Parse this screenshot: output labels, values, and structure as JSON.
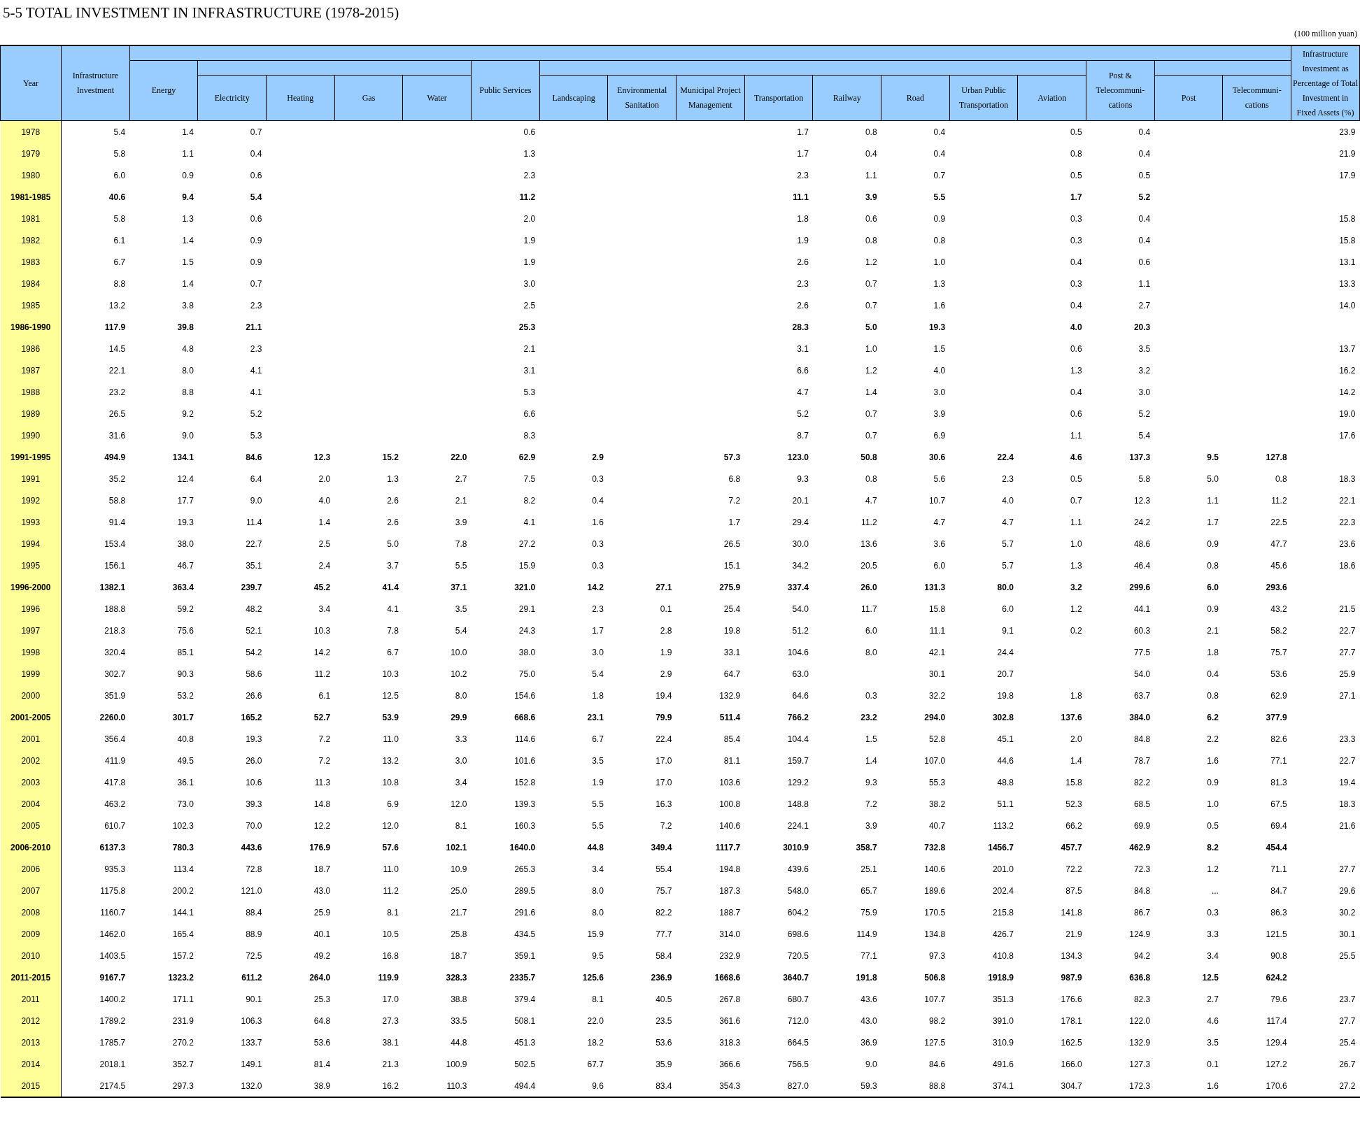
{
  "title": "5-5 TOTAL INVESTMENT IN INFRASTRUCTURE (1978-2015)",
  "unit": "(100 million yuan)",
  "table": {
    "header": {
      "year": "Year",
      "infra": "Infrastructure Investment",
      "groups": [
        {
          "total": "Energy",
          "items": [
            "Electricity",
            "Heating",
            "Gas",
            "Water"
          ]
        },
        {
          "total": "Public Services",
          "items": [
            "Landscaping",
            "Environmental Sanitation",
            "Municipal Project Management",
            "Transportation",
            "Railway",
            "Road",
            "Urban Public Transportation",
            "Aviation"
          ]
        },
        {
          "total": "Post & Telecommuni-cations",
          "items": [
            "Post",
            "Telecommuni-cations"
          ]
        }
      ],
      "pct_fixed_assets": "Infrastructure Investment as Percentage of Total Investment in Fixed Assets (%)"
    },
    "rows": [
      {
        "year": "1978",
        "kind": "year",
        "infra": "5.4",
        "energy": "1.4",
        "electricity": "0.7",
        "public_services": "0.6",
        "transportation": "1.7",
        "railway": "0.8",
        "road": "0.4",
        "aviation": "0.5",
        "post_telecom": "0.4",
        "pct_fixed_assets": "23.9"
      },
      {
        "year": "1979",
        "kind": "year",
        "infra": "5.8",
        "energy": "1.1",
        "electricity": "0.4",
        "public_services": "1.3",
        "transportation": "1.7",
        "railway": "0.4",
        "road": "0.4",
        "aviation": "0.8",
        "post_telecom": "0.4",
        "pct_fixed_assets": "21.9"
      },
      {
        "year": "1980",
        "kind": "year",
        "infra": "6.0",
        "energy": "0.9",
        "electricity": "0.6",
        "public_services": "2.3",
        "transportation": "2.3",
        "railway": "1.1",
        "road": "0.7",
        "aviation": "0.5",
        "post_telecom": "0.5",
        "pct_fixed_assets": "17.9"
      },
      {
        "year": "1981-1985",
        "kind": "period",
        "infra": "40.6",
        "energy": "9.4",
        "electricity": "5.4",
        "public_services": "11.2",
        "transportation": "11.1",
        "railway": "3.9",
        "road": "5.5",
        "aviation": "1.7",
        "post_telecom": "5.2"
      },
      {
        "year": "1981",
        "kind": "year",
        "infra": "5.8",
        "energy": "1.3",
        "electricity": "0.6",
        "public_services": "2.0",
        "transportation": "1.8",
        "railway": "0.6",
        "road": "0.9",
        "aviation": "0.3",
        "post_telecom": "0.4",
        "pct_fixed_assets": "15.8"
      },
      {
        "year": "1982",
        "kind": "year",
        "infra": "6.1",
        "energy": "1.4",
        "electricity": "0.9",
        "public_services": "1.9",
        "transportation": "1.9",
        "railway": "0.8",
        "road": "0.8",
        "aviation": "0.3",
        "post_telecom": "0.4",
        "pct_fixed_assets": "15.8"
      },
      {
        "year": "1983",
        "kind": "year",
        "infra": "6.7",
        "energy": "1.5",
        "electricity": "0.9",
        "public_services": "1.9",
        "transportation": "2.6",
        "railway": "1.2",
        "road": "1.0",
        "aviation": "0.4",
        "post_telecom": "0.6",
        "pct_fixed_assets": "13.1"
      },
      {
        "year": "1984",
        "kind": "year",
        "infra": "8.8",
        "energy": "1.4",
        "electricity": "0.7",
        "public_services": "3.0",
        "transportation": "2.3",
        "railway": "0.7",
        "road": "1.3",
        "aviation": "0.3",
        "post_telecom": "1.1",
        "pct_fixed_assets": "13.3"
      },
      {
        "year": "1985",
        "kind": "year",
        "infra": "13.2",
        "energy": "3.8",
        "electricity": "2.3",
        "public_services": "2.5",
        "transportation": "2.6",
        "railway": "0.7",
        "road": "1.6",
        "aviation": "0.4",
        "post_telecom": "2.7",
        "pct_fixed_assets": "14.0"
      },
      {
        "year": "1986-1990",
        "kind": "period",
        "infra": "117.9",
        "energy": "39.8",
        "electricity": "21.1",
        "public_services": "25.3",
        "transportation": "28.3",
        "railway": "5.0",
        "road": "19.3",
        "aviation": "4.0",
        "post_telecom": "20.3"
      },
      {
        "year": "1986",
        "kind": "year",
        "infra": "14.5",
        "energy": "4.8",
        "electricity": "2.3",
        "public_services": "2.1",
        "transportation": "3.1",
        "railway": "1.0",
        "road": "1.5",
        "aviation": "0.6",
        "post_telecom": "3.5",
        "pct_fixed_assets": "13.7"
      },
      {
        "year": "1987",
        "kind": "year",
        "infra": "22.1",
        "energy": "8.0",
        "electricity": "4.1",
        "public_services": "3.1",
        "transportation": "6.6",
        "railway": "1.2",
        "road": "4.0",
        "aviation": "1.3",
        "post_telecom": "3.2",
        "pct_fixed_assets": "16.2"
      },
      {
        "year": "1988",
        "kind": "year",
        "infra": "23.2",
        "energy": "8.8",
        "electricity": "4.1",
        "public_services": "5.3",
        "transportation": "4.7",
        "railway": "1.4",
        "road": "3.0",
        "aviation": "0.4",
        "post_telecom": "3.0",
        "pct_fixed_assets": "14.2"
      },
      {
        "year": "1989",
        "kind": "year",
        "infra": "26.5",
        "energy": "9.2",
        "electricity": "5.2",
        "public_services": "6.6",
        "transportation": "5.2",
        "railway": "0.7",
        "road": "3.9",
        "aviation": "0.6",
        "post_telecom": "5.2",
        "pct_fixed_assets": "19.0"
      },
      {
        "year": "1990",
        "kind": "year",
        "infra": "31.6",
        "energy": "9.0",
        "electricity": "5.3",
        "public_services": "8.3",
        "transportation": "8.7",
        "railway": "0.7",
        "road": "6.9",
        "aviation": "1.1",
        "post_telecom": "5.4",
        "pct_fixed_assets": "17.6"
      },
      {
        "year": "1991-1995",
        "kind": "period",
        "infra": "494.9",
        "energy": "134.1",
        "electricity": "84.6",
        "heating": "12.3",
        "gas": "15.2",
        "water": "22.0",
        "public_services": "62.9",
        "landscaping": "2.9",
        "municipal": "57.3",
        "transportation": "123.0",
        "railway": "50.8",
        "road": "30.6",
        "urban_transit": "22.4",
        "aviation": "4.6",
        "post_telecom": "137.3",
        "post": "9.5",
        "telecom": "127.8"
      },
      {
        "year": "1991",
        "kind": "year",
        "infra": "35.2",
        "energy": "12.4",
        "electricity": "6.4",
        "heating": "2.0",
        "gas": "1.3",
        "water": "2.7",
        "public_services": "7.5",
        "landscaping": "0.3",
        "municipal": "6.8",
        "transportation": "9.3",
        "railway": "0.8",
        "road": "5.6",
        "urban_transit": "2.3",
        "aviation": "0.5",
        "post_telecom": "5.8",
        "post": "5.0",
        "telecom": "0.8",
        "pct_fixed_assets": "18.3"
      },
      {
        "year": "1992",
        "kind": "year",
        "infra": "58.8",
        "energy": "17.7",
        "electricity": "9.0",
        "heating": "4.0",
        "gas": "2.6",
        "water": "2.1",
        "public_services": "8.2",
        "landscaping": "0.4",
        "municipal": "7.2",
        "transportation": "20.1",
        "railway": "4.7",
        "road": "10.7",
        "urban_transit": "4.0",
        "aviation": "0.7",
        "post_telecom": "12.3",
        "post": "1.1",
        "telecom": "11.2",
        "pct_fixed_assets": "22.1"
      },
      {
        "year": "1993",
        "kind": "year",
        "infra": "91.4",
        "energy": "19.3",
        "electricity": "11.4",
        "heating": "1.4",
        "gas": "2.6",
        "water": "3.9",
        "public_services": "4.1",
        "landscaping": "1.6",
        "municipal": "1.7",
        "transportation": "29.4",
        "railway": "11.2",
        "road": "4.7",
        "urban_transit": "4.7",
        "aviation": "1.1",
        "post_telecom": "24.2",
        "post": "1.7",
        "telecom": "22.5",
        "pct_fixed_assets": "22.3"
      },
      {
        "year": "1994",
        "kind": "year",
        "infra": "153.4",
        "energy": "38.0",
        "electricity": "22.7",
        "heating": "2.5",
        "gas": "5.0",
        "water": "7.8",
        "public_services": "27.2",
        "landscaping": "0.3",
        "municipal": "26.5",
        "transportation": "30.0",
        "railway": "13.6",
        "road": "3.6",
        "urban_transit": "5.7",
        "aviation": "1.0",
        "post_telecom": "48.6",
        "post": "0.9",
        "telecom": "47.7",
        "pct_fixed_assets": "23.6"
      },
      {
        "year": "1995",
        "kind": "year",
        "infra": "156.1",
        "energy": "46.7",
        "electricity": "35.1",
        "heating": "2.4",
        "gas": "3.7",
        "water": "5.5",
        "public_services": "15.9",
        "landscaping": "0.3",
        "municipal": "15.1",
        "transportation": "34.2",
        "railway": "20.5",
        "road": "6.0",
        "urban_transit": "5.7",
        "aviation": "1.3",
        "post_telecom": "46.4",
        "post": "0.8",
        "telecom": "45.6",
        "pct_fixed_assets": "18.6"
      },
      {
        "year": "1996-2000",
        "kind": "period",
        "infra": "1382.1",
        "energy": "363.4",
        "electricity": "239.7",
        "heating": "45.2",
        "gas": "41.4",
        "water": "37.1",
        "public_services": "321.0",
        "landscaping": "14.2",
        "sanitation": "27.1",
        "municipal": "275.9",
        "transportation": "337.4",
        "railway": "26.0",
        "road": "131.3",
        "urban_transit": "80.0",
        "aviation": "3.2",
        "post_telecom": "299.6",
        "post": "6.0",
        "telecom": "293.6"
      },
      {
        "year": "1996",
        "kind": "year",
        "infra": "188.8",
        "energy": "59.2",
        "electricity": "48.2",
        "heating": "3.4",
        "gas": "4.1",
        "water": "3.5",
        "public_services": "29.1",
        "landscaping": "2.3",
        "sanitation": "0.1",
        "municipal": "25.4",
        "transportation": "54.0",
        "railway": "11.7",
        "road": "15.8",
        "urban_transit": "6.0",
        "aviation": "1.2",
        "post_telecom": "44.1",
        "post": "0.9",
        "telecom": "43.2",
        "pct_fixed_assets": "21.5"
      },
      {
        "year": "1997",
        "kind": "year",
        "infra": "218.3",
        "energy": "75.6",
        "electricity": "52.1",
        "heating": "10.3",
        "gas": "7.8",
        "water": "5.4",
        "public_services": "24.3",
        "landscaping": "1.7",
        "sanitation": "2.8",
        "municipal": "19.8",
        "transportation": "51.2",
        "railway": "6.0",
        "road": "11.1",
        "urban_transit": "9.1",
        "aviation": "0.2",
        "post_telecom": "60.3",
        "post": "2.1",
        "telecom": "58.2",
        "pct_fixed_assets": "22.7"
      },
      {
        "year": "1998",
        "kind": "year",
        "infra": "320.4",
        "energy": "85.1",
        "electricity": "54.2",
        "heating": "14.2",
        "gas": "6.7",
        "water": "10.0",
        "public_services": "38.0",
        "landscaping": "3.0",
        "sanitation": "1.9",
        "municipal": "33.1",
        "transportation": "104.6",
        "railway": "8.0",
        "road": "42.1",
        "urban_transit": "24.4",
        "post_telecom": "77.5",
        "post": "1.8",
        "telecom": "75.7",
        "pct_fixed_assets": "27.7"
      },
      {
        "year": "1999",
        "kind": "year",
        "infra": "302.7",
        "energy": "90.3",
        "electricity": "58.6",
        "heating": "11.2",
        "gas": "10.3",
        "water": "10.2",
        "public_services": "75.0",
        "landscaping": "5.4",
        "sanitation": "2.9",
        "municipal": "64.7",
        "transportation": "63.0",
        "road": "30.1",
        "urban_transit": "20.7",
        "post_telecom": "54.0",
        "post": "0.4",
        "telecom": "53.6",
        "pct_fixed_assets": "25.9"
      },
      {
        "year": "2000",
        "kind": "year",
        "infra": "351.9",
        "energy": "53.2",
        "electricity": "26.6",
        "heating": "6.1",
        "gas": "12.5",
        "water": "8.0",
        "public_services": "154.6",
        "landscaping": "1.8",
        "sanitation": "19.4",
        "municipal": "132.9",
        "transportation": "64.6",
        "railway": "0.3",
        "road": "32.2",
        "urban_transit": "19.8",
        "aviation": "1.8",
        "post_telecom": "63.7",
        "post": "0.8",
        "telecom": "62.9",
        "pct_fixed_assets": "27.1"
      },
      {
        "year": "2001-2005",
        "kind": "period",
        "infra": "2260.0",
        "energy": "301.7",
        "electricity": "165.2",
        "heating": "52.7",
        "gas": "53.9",
        "water": "29.9",
        "public_services": "668.6",
        "landscaping": "23.1",
        "sanitation": "79.9",
        "municipal": "511.4",
        "transportation": "766.2",
        "railway": "23.2",
        "road": "294.0",
        "urban_transit": "302.8",
        "aviation": "137.6",
        "post_telecom": "384.0",
        "post": "6.2",
        "telecom": "377.9"
      },
      {
        "year": "2001",
        "kind": "year",
        "infra": "356.4",
        "energy": "40.8",
        "electricity": "19.3",
        "heating": "7.2",
        "gas": "11.0",
        "water": "3.3",
        "public_services": "114.6",
        "landscaping": "6.7",
        "sanitation": "22.4",
        "municipal": "85.4",
        "transportation": "104.4",
        "railway": "1.5",
        "road": "52.8",
        "urban_transit": "45.1",
        "aviation": "2.0",
        "post_telecom": "84.8",
        "post": "2.2",
        "telecom": "82.6",
        "pct_fixed_assets": "23.3"
      },
      {
        "year": "2002",
        "kind": "year",
        "infra": "411.9",
        "energy": "49.5",
        "electricity": "26.0",
        "heating": "7.2",
        "gas": "13.2",
        "water": "3.0",
        "public_services": "101.6",
        "landscaping": "3.5",
        "sanitation": "17.0",
        "municipal": "81.1",
        "transportation": "159.7",
        "railway": "1.4",
        "road": "107.0",
        "urban_transit": "44.6",
        "aviation": "1.4",
        "post_telecom": "78.7",
        "post": "1.6",
        "telecom": "77.1",
        "pct_fixed_assets": "22.7"
      },
      {
        "year": "2003",
        "kind": "year",
        "infra": "417.8",
        "energy": "36.1",
        "electricity": "10.6",
        "heating": "11.3",
        "gas": "10.8",
        "water": "3.4",
        "public_services": "152.8",
        "landscaping": "1.9",
        "sanitation": "17.0",
        "municipal": "103.6",
        "transportation": "129.2",
        "railway": "9.3",
        "road": "55.3",
        "urban_transit": "48.8",
        "aviation": "15.8",
        "post_telecom": "82.2",
        "post": "0.9",
        "telecom": "81.3",
        "pct_fixed_assets": "19.4"
      },
      {
        "year": "2004",
        "kind": "year",
        "infra": "463.2",
        "energy": "73.0",
        "electricity": "39.3",
        "heating": "14.8",
        "gas": "6.9",
        "water": "12.0",
        "public_services": "139.3",
        "landscaping": "5.5",
        "sanitation": "16.3",
        "municipal": "100.8",
        "transportation": "148.8",
        "railway": "7.2",
        "road": "38.2",
        "urban_transit": "51.1",
        "aviation": "52.3",
        "post_telecom": "68.5",
        "post": "1.0",
        "telecom": "67.5",
        "pct_fixed_assets": "18.3"
      },
      {
        "year": "2005",
        "kind": "year",
        "infra": "610.7",
        "energy": "102.3",
        "electricity": "70.0",
        "heating": "12.2",
        "gas": "12.0",
        "water": "8.1",
        "public_services": "160.3",
        "landscaping": "5.5",
        "sanitation": "7.2",
        "municipal": "140.6",
        "transportation": "224.1",
        "railway": "3.9",
        "road": "40.7",
        "urban_transit": "113.2",
        "aviation": "66.2",
        "post_telecom": "69.9",
        "post": "0.5",
        "telecom": "69.4",
        "pct_fixed_assets": "21.6"
      },
      {
        "year": "2006-2010",
        "kind": "period",
        "infra": "6137.3",
        "energy": "780.3",
        "electricity": "443.6",
        "heating": "176.9",
        "gas": "57.6",
        "water": "102.1",
        "public_services": "1640.0",
        "landscaping": "44.8",
        "sanitation": "349.4",
        "municipal": "1117.7",
        "transportation": "3010.9",
        "railway": "358.7",
        "road": "732.8",
        "urban_transit": "1456.7",
        "aviation": "457.7",
        "post_telecom": "462.9",
        "post": "8.2",
        "telecom": "454.4"
      },
      {
        "year": "2006",
        "kind": "year",
        "infra": "935.3",
        "energy": "113.4",
        "electricity": "72.8",
        "heating": "18.7",
        "gas": "11.0",
        "water": "10.9",
        "public_services": "265.3",
        "landscaping": "3.4",
        "sanitation": "55.4",
        "municipal": "194.8",
        "transportation": "439.6",
        "railway": "25.1",
        "road": "140.6",
        "urban_transit": "201.0",
        "aviation": "72.2",
        "post_telecom": "72.3",
        "post": "1.2",
        "telecom": "71.1",
        "pct_fixed_assets": "27.7"
      },
      {
        "year": "2007",
        "kind": "year",
        "infra": "1175.8",
        "energy": "200.2",
        "electricity": "121.0",
        "heating": "43.0",
        "gas": "11.2",
        "water": "25.0",
        "public_services": "289.5",
        "landscaping": "8.0",
        "sanitation": "75.7",
        "municipal": "187.3",
        "transportation": "548.0",
        "railway": "65.7",
        "road": "189.6",
        "urban_transit": "202.4",
        "aviation": "87.5",
        "post_telecom": "84.8",
        "post": "...",
        "telecom": "84.7",
        "pct_fixed_assets": "29.6"
      },
      {
        "year": "2008",
        "kind": "year",
        "infra": "1160.7",
        "energy": "144.1",
        "electricity": "88.4",
        "heating": "25.9",
        "gas": "8.1",
        "water": "21.7",
        "public_services": "291.6",
        "landscaping": "8.0",
        "sanitation": "82.2",
        "municipal": "188.7",
        "transportation": "604.2",
        "railway": "75.9",
        "road": "170.5",
        "urban_transit": "215.8",
        "aviation": "141.8",
        "post_telecom": "86.7",
        "post": "0.3",
        "telecom": "86.3",
        "pct_fixed_assets": "30.2"
      },
      {
        "year": "2009",
        "kind": "year",
        "infra": "1462.0",
        "energy": "165.4",
        "electricity": "88.9",
        "heating": "40.1",
        "gas": "10.5",
        "water": "25.8",
        "public_services": "434.5",
        "landscaping": "15.9",
        "sanitation": "77.7",
        "municipal": "314.0",
        "transportation": "698.6",
        "railway": "114.9",
        "road": "134.8",
        "urban_transit": "426.7",
        "aviation": "21.9",
        "post_telecom": "124.9",
        "post": "3.3",
        "telecom": "121.5",
        "pct_fixed_assets": "30.1"
      },
      {
        "year": "2010",
        "kind": "year",
        "infra": "1403.5",
        "energy": "157.2",
        "electricity": "72.5",
        "heating": "49.2",
        "gas": "16.8",
        "water": "18.7",
        "public_services": "359.1",
        "landscaping": "9.5",
        "sanitation": "58.4",
        "municipal": "232.9",
        "transportation": "720.5",
        "railway": "77.1",
        "road": "97.3",
        "urban_transit": "410.8",
        "aviation": "134.3",
        "post_telecom": "94.2",
        "post": "3.4",
        "telecom": "90.8",
        "pct_fixed_assets": "25.5"
      },
      {
        "year": "2011-2015",
        "kind": "period",
        "infra": "9167.7",
        "energy": "1323.2",
        "electricity": "611.2",
        "heating": "264.0",
        "gas": "119.9",
        "water": "328.3",
        "public_services": "2335.7",
        "landscaping": "125.6",
        "sanitation": "236.9",
        "municipal": "1668.6",
        "transportation": "3640.7",
        "railway": "191.8",
        "road": "506.8",
        "urban_transit": "1918.9",
        "aviation": "987.9",
        "post_telecom": "636.8",
        "post": "12.5",
        "telecom": "624.2"
      },
      {
        "year": "2011",
        "kind": "year",
        "infra": "1400.2",
        "energy": "171.1",
        "electricity": "90.1",
        "heating": "25.3",
        "gas": "17.0",
        "water": "38.8",
        "public_services": "379.4",
        "landscaping": "8.1",
        "sanitation": "40.5",
        "municipal": "267.8",
        "transportation": "680.7",
        "railway": "43.6",
        "road": "107.7",
        "urban_transit": "351.3",
        "aviation": "176.6",
        "post_telecom": "82.3",
        "post": "2.7",
        "telecom": "79.6",
        "pct_fixed_assets": "23.7"
      },
      {
        "year": "2012",
        "kind": "year",
        "infra": "1789.2",
        "energy": "231.9",
        "electricity": "106.3",
        "heating": "64.8",
        "gas": "27.3",
        "water": "33.5",
        "public_services": "508.1",
        "landscaping": "22.0",
        "sanitation": "23.5",
        "municipal": "361.6",
        "transportation": "712.0",
        "railway": "43.0",
        "road": "98.2",
        "urban_transit": "391.0",
        "aviation": "178.1",
        "post_telecom": "122.0",
        "post": "4.6",
        "telecom": "117.4",
        "pct_fixed_assets": "27.7"
      },
      {
        "year": "2013",
        "kind": "year",
        "infra": "1785.7",
        "energy": "270.2",
        "electricity": "133.7",
        "heating": "53.6",
        "gas": "38.1",
        "water": "44.8",
        "public_services": "451.3",
        "landscaping": "18.2",
        "sanitation": "53.6",
        "municipal": "318.3",
        "transportation": "664.5",
        "railway": "36.9",
        "road": "127.5",
        "urban_transit": "310.9",
        "aviation": "162.5",
        "post_telecom": "132.9",
        "post": "3.5",
        "telecom": "129.4",
        "pct_fixed_assets": "25.4"
      },
      {
        "year": "2014",
        "kind": "year",
        "infra": "2018.1",
        "energy": "352.7",
        "electricity": "149.1",
        "heating": "81.4",
        "gas": "21.3",
        "water": "100.9",
        "public_services": "502.5",
        "landscaping": "67.7",
        "sanitation": "35.9",
        "municipal": "366.6",
        "transportation": "756.5",
        "railway": "9.0",
        "road": "84.6",
        "urban_transit": "491.6",
        "aviation": "166.0",
        "post_telecom": "127.3",
        "post": "0.1",
        "telecom": "127.2",
        "pct_fixed_assets": "26.7"
      },
      {
        "year": "2015",
        "kind": "year",
        "infra": "2174.5",
        "energy": "297.3",
        "electricity": "132.0",
        "heating": "38.9",
        "gas": "16.2",
        "water": "110.3",
        "public_services": "494.4",
        "landscaping": "9.6",
        "sanitation": "83.4",
        "municipal": "354.3",
        "transportation": "827.0",
        "railway": "59.3",
        "road": "88.8",
        "urban_transit": "374.1",
        "aviation": "304.7",
        "post_telecom": "172.3",
        "post": "1.6",
        "telecom": "170.6",
        "pct_fixed_assets": "27.2"
      }
    ]
  }
}
